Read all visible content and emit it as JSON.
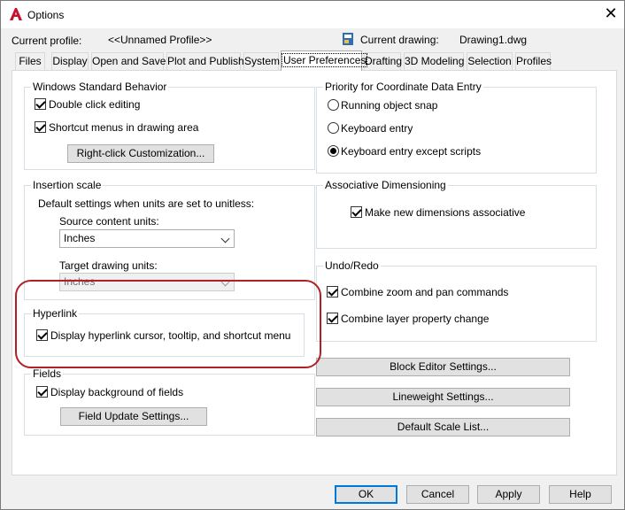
{
  "window": {
    "title": "Options",
    "close_glyph": "✕",
    "icons": {
      "app": "autocad-a-icon",
      "drawing": "drawing-file-icon",
      "close": "close-icon"
    }
  },
  "profile": {
    "label": "Current profile:",
    "value": "<<Unnamed Profile>>",
    "drawing_label": "Current drawing:",
    "drawing_value": "Drawing1.dwg"
  },
  "tabs": [
    {
      "label": "Files"
    },
    {
      "label": "Display"
    },
    {
      "label": "Open and Save"
    },
    {
      "label": "Plot and Publish"
    },
    {
      "label": "System"
    },
    {
      "label": "User Preferences",
      "active": true
    },
    {
      "label": "Drafting"
    },
    {
      "label": "3D Modeling"
    },
    {
      "label": "Selection"
    },
    {
      "label": "Profiles"
    }
  ],
  "windows_behavior": {
    "title": "Windows Standard Behavior",
    "double_click": "Double click editing",
    "shortcut_menus": "Shortcut menus in drawing area",
    "right_click_btn": "Right-click Customization..."
  },
  "insertion_scale": {
    "title": "Insertion scale",
    "desc": "Default settings when units are set to unitless:",
    "source_label": "Source content units:",
    "source_value": "Inches",
    "target_label": "Target drawing units:",
    "target_value": "Inches"
  },
  "hyperlink": {
    "title": "Hyperlink",
    "display": "Display hyperlink cursor, tooltip, and shortcut menu"
  },
  "fields": {
    "title": "Fields",
    "display_bg": "Display background of fields",
    "update_btn": "Field Update Settings..."
  },
  "priority": {
    "title": "Priority for Coordinate Data Entry",
    "options": [
      {
        "label": "Running object snap",
        "selected": false
      },
      {
        "label": "Keyboard entry",
        "selected": false
      },
      {
        "label": "Keyboard entry except scripts",
        "selected": true
      }
    ]
  },
  "assoc_dim": {
    "title": "Associative Dimensioning",
    "make_assoc": "Make new dimensions associative"
  },
  "undo_redo": {
    "title": "Undo/Redo",
    "combine_zoom": "Combine zoom and pan commands",
    "combine_layer": "Combine layer property change"
  },
  "buttons": {
    "block_editor": "Block Editor Settings...",
    "lineweight": "Lineweight Settings...",
    "default_scale": "Default Scale List...",
    "ok": "OK",
    "cancel": "Cancel",
    "apply": "Apply",
    "help": "Help"
  },
  "colors": {
    "highlight": "#b22025",
    "accent": "#0078d7",
    "app_icon": "#c8102e"
  }
}
